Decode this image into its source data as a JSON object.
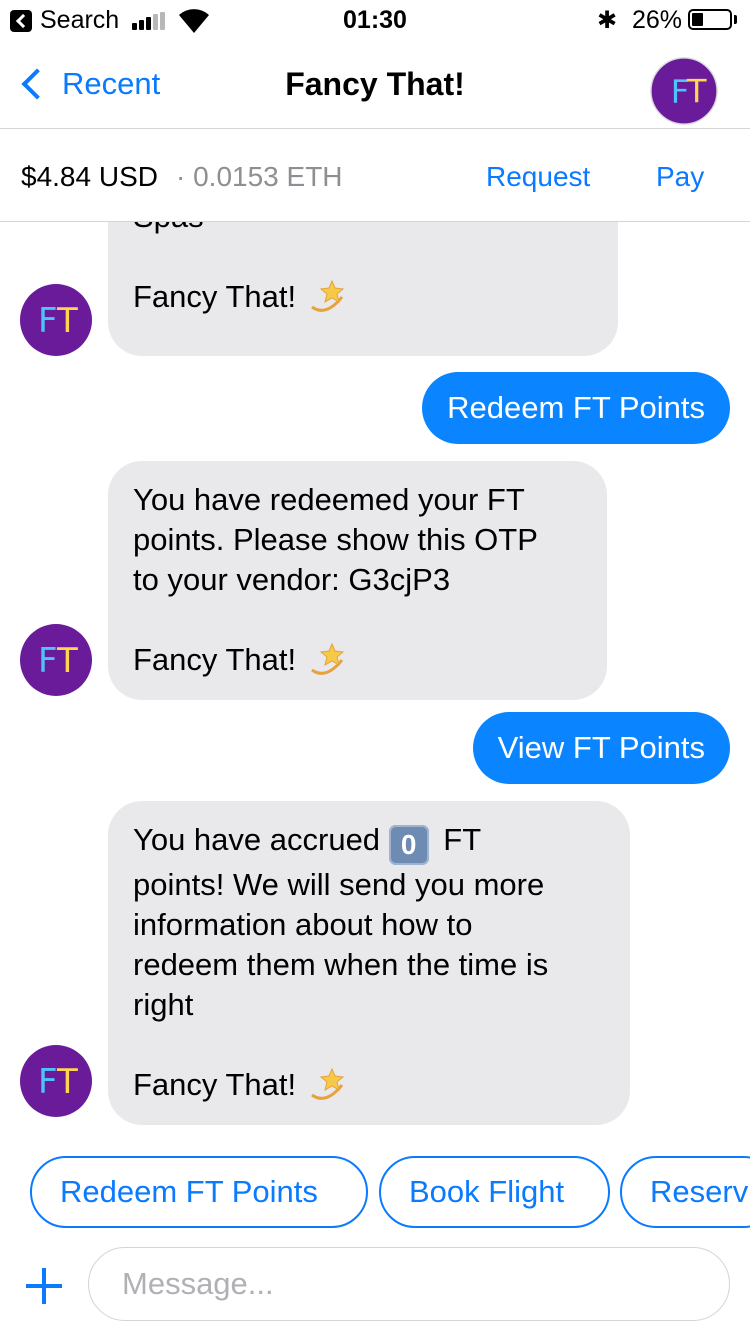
{
  "status_bar": {
    "back_app": "Search",
    "time": "01:30",
    "battery": "26%",
    "icons": [
      "back-app-icon",
      "cellular-signal-icon",
      "wifi-icon",
      "bluetooth-icon",
      "battery-icon"
    ],
    "signal_bars": 3,
    "signal_bars_total": 5,
    "battery_level": 0.26
  },
  "nav": {
    "back_label": "Recent",
    "title": "Fancy That!",
    "avatar_initials": "FT"
  },
  "payment": {
    "usd": "$4.84 USD",
    "eth": "· 0.0153 ETH",
    "request_label": "Request",
    "pay_label": "Pay"
  },
  "messages": [
    {
      "from": "bot",
      "lines": [
        "Spas"
      ],
      "signature": "Fancy That!",
      "emoji": "dizzy-star-icon"
    },
    {
      "from": "user",
      "text": "Redeem FT Points"
    },
    {
      "from": "bot",
      "lines": [
        "You have redeemed your FT",
        "points. Please show this OTP",
        "to your vendor: G3cjP3"
      ],
      "signature": "Fancy That!",
      "emoji": "dizzy-star-icon"
    },
    {
      "from": "user",
      "text": "View FT Points"
    },
    {
      "from": "bot",
      "pre_keycap": "You have accrued ",
      "keycap": "0",
      "post_keycap": " FT",
      "lines": [
        "points! We will send you more",
        "information about how to",
        "redeem them when the time is",
        "right"
      ],
      "signature": "Fancy That!",
      "emoji": "dizzy-star-icon"
    }
  ],
  "quick_replies": [
    "Redeem FT Points",
    "Book Flight",
    "Reserv"
  ],
  "composer": {
    "placeholder": "Message...",
    "value": "",
    "add_icon": "plus-icon"
  },
  "colors": {
    "accent": "#0a7aff",
    "outgoing_bubble": "#0a84ff",
    "incoming_bubble": "#e9e9eb",
    "avatar_bg": "#6a1b9a",
    "avatar_letter_f": "#4fc3f7",
    "avatar_letter_t": "#ffd54f"
  }
}
